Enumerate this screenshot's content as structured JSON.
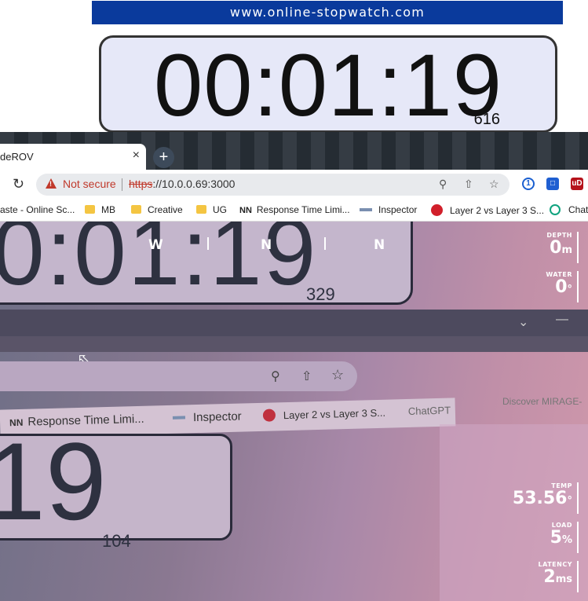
{
  "stopwatch": {
    "site": "www.online-stopwatch.com",
    "time": "00:01:19",
    "ms": "616"
  },
  "browser": {
    "tab_title": "deROV",
    "tab_close": "×",
    "new_tab": "+",
    "not_secure": "Not secure",
    "url_scheme": "https",
    "url_rest": "://10.0.0.69:3000",
    "bookmarks": [
      "aste - Online Sc...",
      "MB",
      "Creative",
      "UG",
      "Response Time Limi...",
      "Inspector",
      "Layer 2 vs Layer 3 S...",
      "Chat"
    ]
  },
  "camera": {
    "time_top": "0:01:19",
    "ms_top": "329",
    "bookmarks": [
      "Response Time Limi...",
      "Inspector",
      "Layer 2 vs Layer 3 S...",
      "ChatGPT",
      "Discover MIRAGE-"
    ],
    "time_bottom": "19",
    "ms_bottom": "104"
  },
  "compass": {
    "left": "W",
    "center": "N",
    "right": "N"
  },
  "hud": {
    "depth_label": "DEPTH",
    "depth_value": "0",
    "depth_unit": "m",
    "water_label": "WATER",
    "water_value": "0",
    "water_unit": "°",
    "temp_label": "TEMP",
    "temp_value": "53.56",
    "temp_unit": "°",
    "load_label": "LOAD",
    "load_value": "5",
    "load_unit": "%",
    "latency_label": "LATENCY",
    "latency_value": "2",
    "latency_unit": "ms"
  }
}
